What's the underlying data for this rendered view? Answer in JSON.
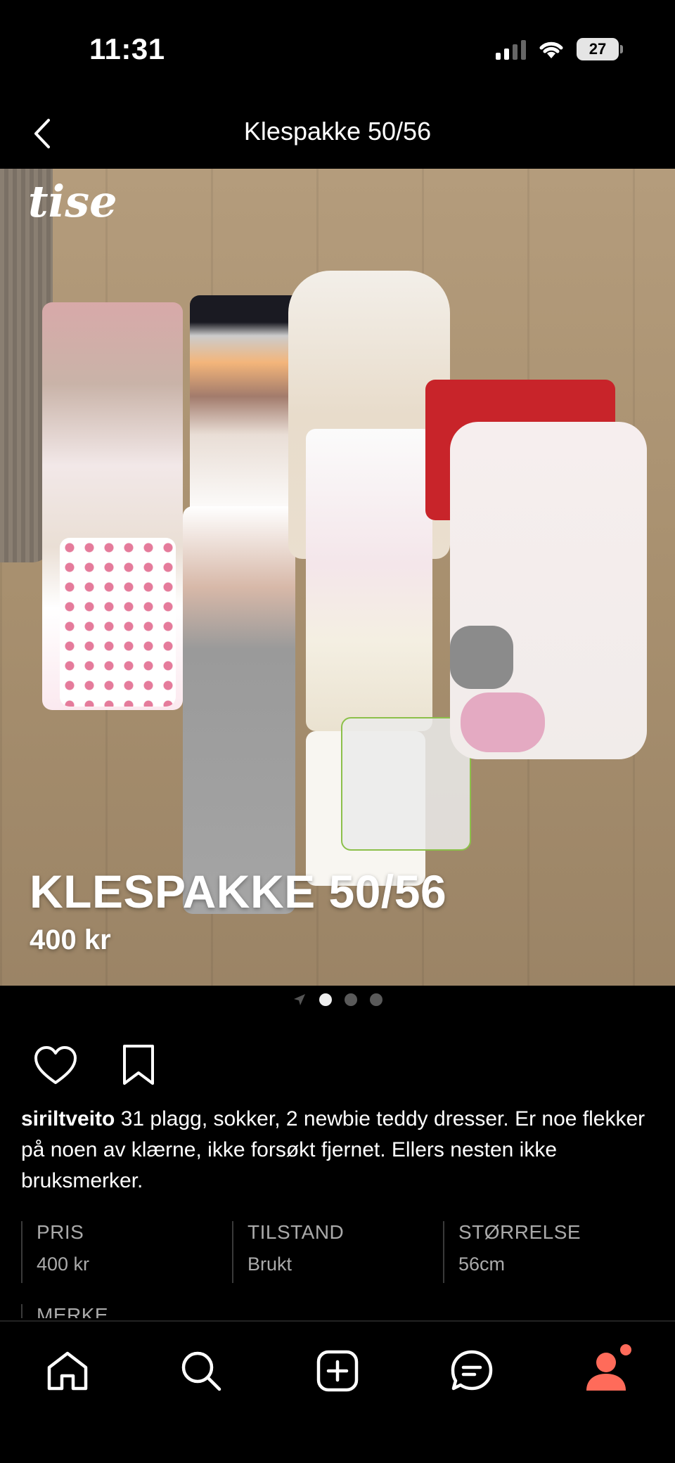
{
  "status": {
    "time": "11:31",
    "battery": "27"
  },
  "nav": {
    "title": "Klespakke 50/56"
  },
  "photo": {
    "brand": "tise",
    "title": "KLESPAKKE 50/56",
    "price": "400 kr"
  },
  "pager": {
    "count": 3,
    "active": 0
  },
  "description": {
    "user": "siriltveito",
    "text": "31 plagg, sokker, 2 newbie teddy dresser. Er noe flekker på noen av klærne, ikke forsøkt fjernet. Ellers nesten ikke bruksmerker."
  },
  "specs": [
    {
      "label": "PRIS",
      "value": "400 kr"
    },
    {
      "label": "TILSTAND",
      "value": "Brukt"
    },
    {
      "label": "STØRRELSE",
      "value": "56cm"
    }
  ],
  "specs_cut": {
    "label": "MERKE"
  },
  "tabbar": {
    "items": [
      "home-icon",
      "search-icon",
      "add-icon",
      "chat-icon",
      "profile-icon"
    ],
    "accent": "#ff6b5a"
  }
}
